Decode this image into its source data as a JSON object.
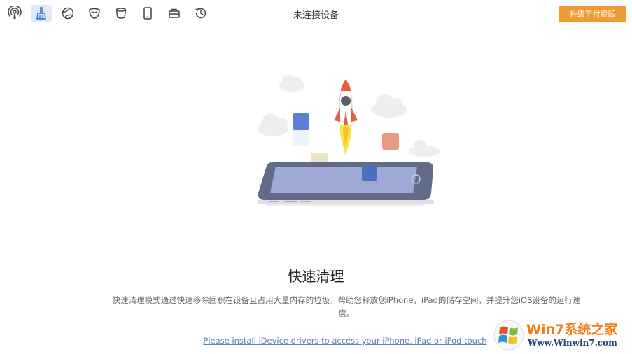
{
  "toolbar": {
    "tools": [
      {
        "icon": "podcast-icon"
      },
      {
        "icon": "broom-icon",
        "active": true
      },
      {
        "icon": "globe-icon"
      },
      {
        "icon": "mask-icon"
      },
      {
        "icon": "bucket-icon"
      },
      {
        "icon": "phone-icon"
      },
      {
        "icon": "toolbox-icon"
      },
      {
        "icon": "history-icon"
      }
    ],
    "device_status": "未连接设备",
    "upgrade_label": "升级至付费版",
    "upgrade_color": "#f09a35"
  },
  "main": {
    "title": "快速清理",
    "description": "快速清理模式通过快速移除囤积在设备且占用大量内存的垃圾，帮助您释放您iPhone，iPad的储存空间，并提升您iOS设备的运行速度。",
    "driver_link": "Please install iDevice drivers to access your iPhone, iPad or iPod touch"
  },
  "watermark": {
    "brand": "Win7系统之家",
    "url": "Www.Winwin7.com"
  },
  "colors": {
    "accent": "#f09a35",
    "link": "#5a7fb6",
    "active_tool_bg": "#dfe9f7"
  }
}
